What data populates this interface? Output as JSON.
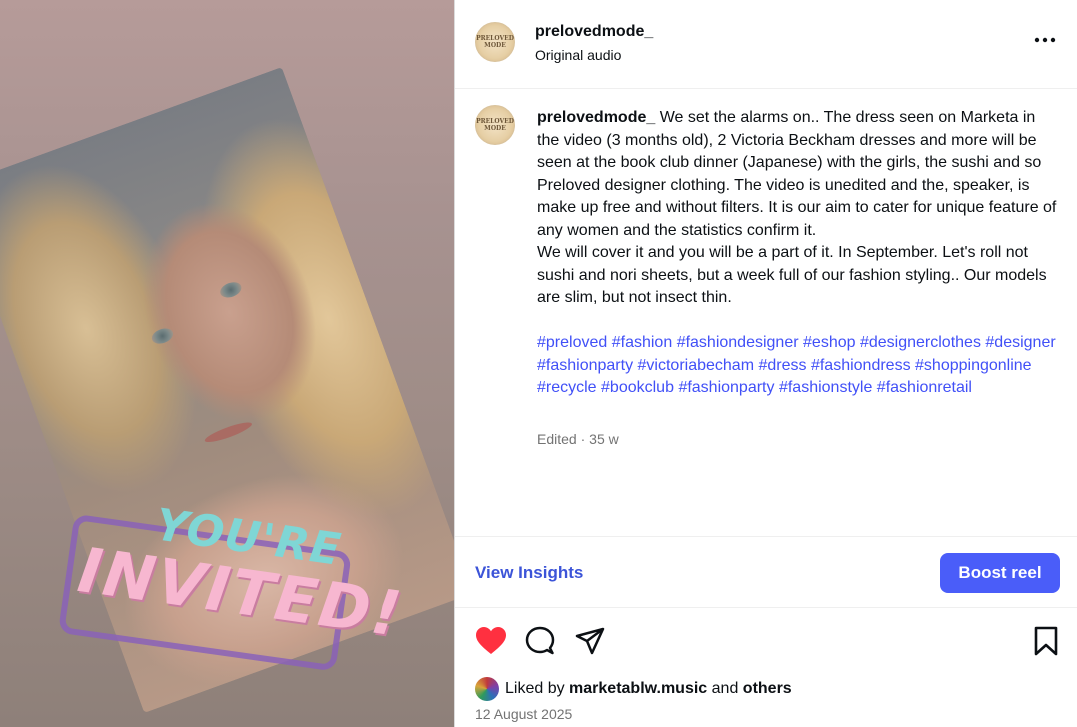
{
  "post": {
    "username": "prelovedmode_",
    "audio": "Original audio",
    "avatar_text": "PRELOVED MODE",
    "caption_text": "We set the alarms on.. The dress seen on Marketa in the video (3 months old), 2 Victoria Beckham dresses and more will be seen at the book club dinner (Japanese) with the girls, the sushi and so Preloved designer clothing. The video is unedited and the, speaker, is make up free and without filters. It is our aim to cater for unique feature of any women and the statistics confirm it.\nWe will cover it and you will be a part of it. In September. Let's roll not sushi and nori sheets, but a week full of our fashion styling.. Our models are slim, but not insect thin.",
    "hashtags": [
      "#preloved",
      "#fashion",
      "#fashiondesigner",
      "#eshop",
      "#designerclothes",
      "#designer",
      "#fashionparty",
      "#victoriabecham",
      "#dress",
      "#fashiondress",
      "#shoppingonline",
      "#recycle",
      "#bookclub",
      "#fashionparty",
      "#fashionstyle",
      "#fashionretail"
    ],
    "edited_label": "Edited",
    "separator": "·",
    "time_ago": "35 w"
  },
  "media": {
    "sticker_line1": "YOU'RE",
    "sticker_line2": "INVITED!"
  },
  "actions": {
    "insights_label": "View Insights",
    "boost_label": "Boost reel",
    "like_icon": "heart-filled-icon",
    "comment_icon": "comment-icon",
    "share_icon": "share-icon",
    "save_icon": "bookmark-icon",
    "more_icon": "more-horizontal-icon"
  },
  "likes": {
    "prefix": "Liked by",
    "user": "marketablw.music",
    "conj": "and",
    "others": "others"
  },
  "date": "12 August 2025",
  "colors": {
    "link": "#4150f7",
    "boost": "#4a5df9",
    "heart": "#ff3040",
    "muted": "#737373"
  }
}
